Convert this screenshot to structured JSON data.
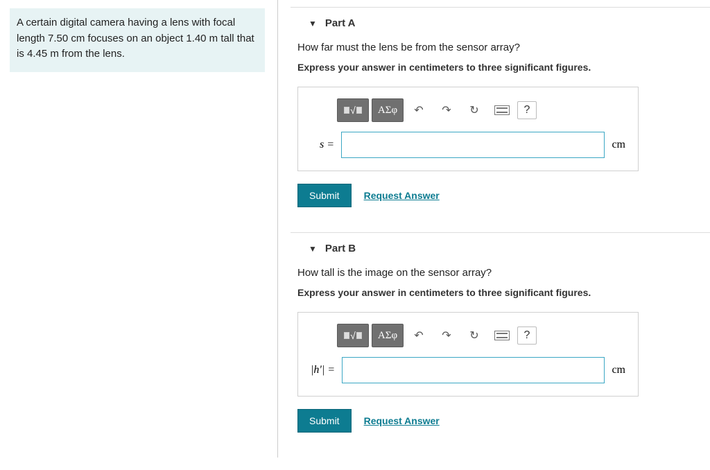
{
  "problem_text": "A certain digital camera having a lens with focal length 7.50 cm focuses on an object 1.40 m tall that is 4.45 m from the lens.",
  "parts": [
    {
      "label": "Part A",
      "question": "How far must the lens be from the sensor array?",
      "instruction": "Express your answer in centimeters to three significant figures.",
      "var_label": "s =",
      "unit": "cm",
      "submit": "Submit",
      "request": "Request Answer"
    },
    {
      "label": "Part B",
      "question": "How tall is the image on the sensor array?",
      "instruction": "Express your answer in centimeters to three significant figures.",
      "var_label": "|h'| =",
      "unit": "cm",
      "submit": "Submit",
      "request": "Request Answer"
    }
  ],
  "toolbar": {
    "greek": "ΑΣφ",
    "undo": "↶",
    "redo": "↷",
    "reset": "↻",
    "help": "?"
  }
}
